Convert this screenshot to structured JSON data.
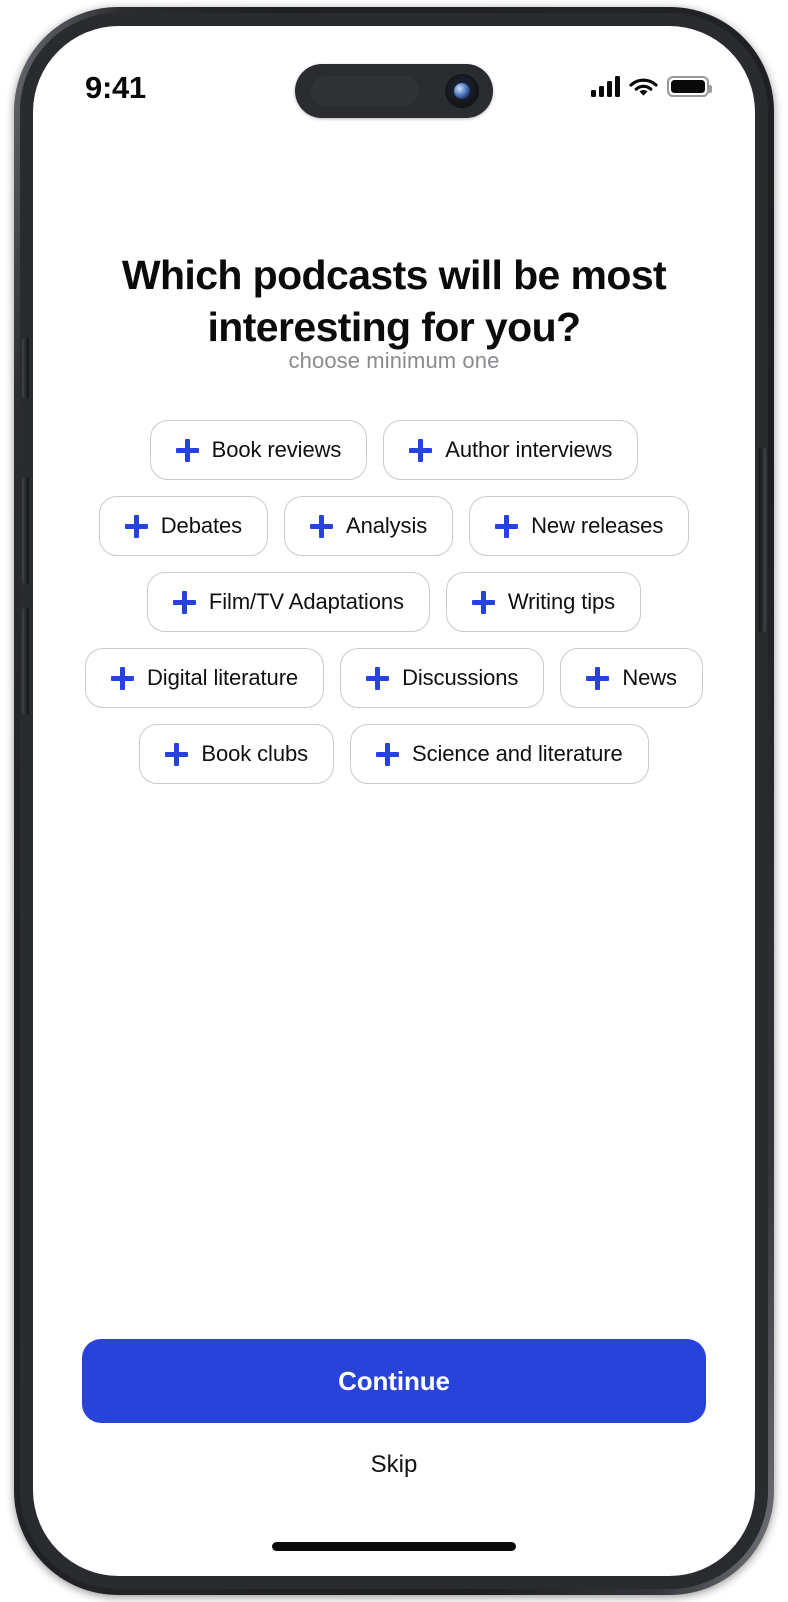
{
  "status_bar": {
    "time": "9:41",
    "signal_icon": "cellular-signal-icon",
    "wifi_icon": "wifi-icon",
    "battery_icon": "battery-full-icon",
    "dynamic_island": "dynamic-island"
  },
  "screen": {
    "title": "Which podcasts will be most interesting for you?",
    "subtitle": "choose minimum one"
  },
  "chip_rows": [
    [
      {
        "label": "Book reviews",
        "icon": "plus-icon"
      },
      {
        "label": "Author interviews",
        "icon": "plus-icon"
      }
    ],
    [
      {
        "label": "Debates",
        "icon": "plus-icon"
      },
      {
        "label": "Analysis",
        "icon": "plus-icon"
      },
      {
        "label": "New releases",
        "icon": "plus-icon"
      }
    ],
    [
      {
        "label": "Film/TV Adaptations",
        "icon": "plus-icon"
      },
      {
        "label": "Writing tips",
        "icon": "plus-icon"
      }
    ],
    [
      {
        "label": "Digital literature",
        "icon": "plus-icon"
      },
      {
        "label": "Discussions",
        "icon": "plus-icon"
      },
      {
        "label": "News",
        "icon": "plus-icon"
      }
    ],
    [
      {
        "label": "Book clubs",
        "icon": "plus-icon"
      },
      {
        "label": "Science and literature",
        "icon": "plus-icon"
      }
    ]
  ],
  "footer": {
    "continue_label": "Continue",
    "skip_label": "Skip"
  },
  "colors": {
    "accent_blue": "#2743d9",
    "chip_border": "#c9c9cf",
    "subtitle_gray": "#8a8a8f",
    "text_black": "#0b0b0b",
    "screen_background": "#ffffff"
  }
}
